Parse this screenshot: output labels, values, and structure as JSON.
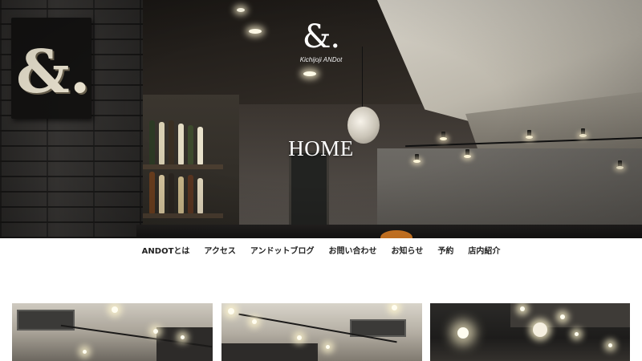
{
  "hero": {
    "logo_mark": "&.",
    "logo_subtitle": "Kichijoji ANDot",
    "sign_glyph": "&.",
    "page_title": "HOME"
  },
  "nav": {
    "items": [
      {
        "label": "ANDOTとは"
      },
      {
        "label": "アクセス"
      },
      {
        "label": "アンドットブログ"
      },
      {
        "label": "お問い合わせ"
      },
      {
        "label": "お知らせ"
      },
      {
        "label": "予約"
      },
      {
        "label": "店内紹介"
      }
    ]
  },
  "gallery": {
    "images": [
      {
        "name": "gallery-image-1"
      },
      {
        "name": "gallery-image-2"
      },
      {
        "name": "gallery-image-3"
      }
    ]
  },
  "colors": {
    "background": "#ffffff",
    "nav_text": "#222222",
    "hero_text": "#ffffff"
  }
}
